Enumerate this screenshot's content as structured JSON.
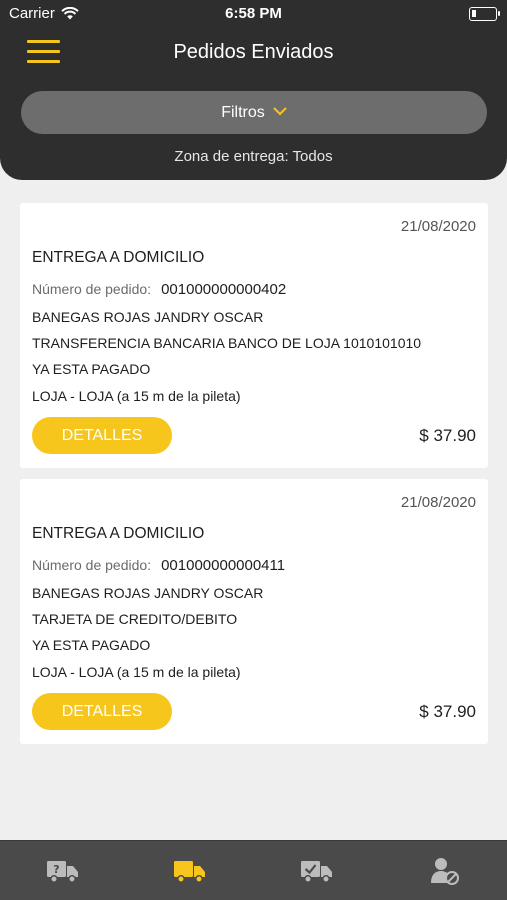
{
  "status_bar": {
    "carrier": "Carrier",
    "time": "6:58 PM"
  },
  "header": {
    "title": "Pedidos Enviados",
    "filters_label": "Filtros",
    "zone_text": "Zona de entrega: Todos"
  },
  "colors": {
    "accent": "#f7c61c",
    "header_bg": "#2e2e2e",
    "tabbar_bg": "#4a4a4a",
    "tab_icon": "#bcbcbc"
  },
  "orders": [
    {
      "date": "21/08/2020",
      "type": "ENTREGA A DOMICILIO",
      "order_label": "Número de pedido:",
      "order_number": "001000000000402",
      "customer": "BANEGAS ROJAS JANDRY OSCAR",
      "payment": "TRANSFERENCIA BANCARIA BANCO DE LOJA 1010101010",
      "payment_status": "YA ESTA PAGADO",
      "address": "LOJA - LOJA (a 15 m de la pileta)",
      "details_label": "DETALLES",
      "price": "$ 37.90"
    },
    {
      "date": "21/08/2020",
      "type": "ENTREGA A DOMICILIO",
      "order_label": "Número de pedido:",
      "order_number": "001000000000411",
      "customer": "BANEGAS ROJAS JANDRY OSCAR",
      "payment": "TARJETA DE CREDITO/DEBITO",
      "payment_status": "YA ESTA PAGADO",
      "address": "LOJA - LOJA (a 15 m de la pileta)",
      "details_label": "DETALLES",
      "price": "$ 37.90"
    }
  ],
  "tab_bar": {
    "tabs": [
      {
        "icon": "truck-question-icon",
        "active": false
      },
      {
        "icon": "delivery-truck-icon",
        "active": true
      },
      {
        "icon": "truck-check-icon",
        "active": false
      },
      {
        "icon": "user-blocked-icon",
        "active": false
      }
    ]
  }
}
